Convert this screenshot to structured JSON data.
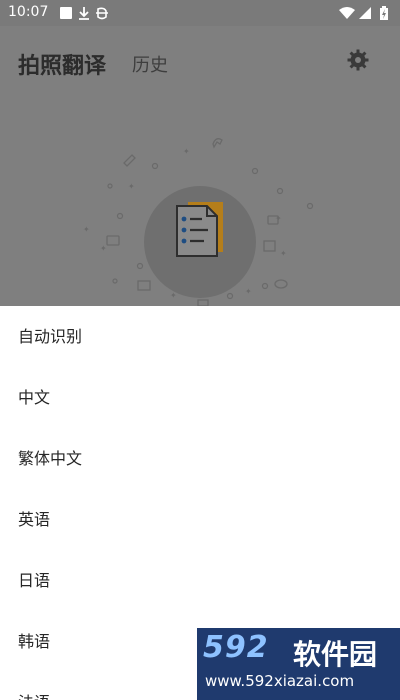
{
  "status_bar": {
    "time": "10:07"
  },
  "app": {
    "title": "拍照翻译",
    "history_tab": "历史",
    "settings_icon": "gear-icon"
  },
  "language_sheet": {
    "items": [
      {
        "label": "自动识别"
      },
      {
        "label": "中文"
      },
      {
        "label": "繁体中文"
      },
      {
        "label": "英语"
      },
      {
        "label": "日语"
      },
      {
        "label": "韩语"
      },
      {
        "label": "法语"
      }
    ]
  },
  "watermark": {
    "brand_num": "592",
    "brand_cn": "软件园",
    "url": "www.592xiazai.com"
  },
  "colors": {
    "scrim": "#7f7f7f",
    "sheet_bg": "#ffffff",
    "text": "#262626",
    "hero_orange": "#d89a2b"
  }
}
